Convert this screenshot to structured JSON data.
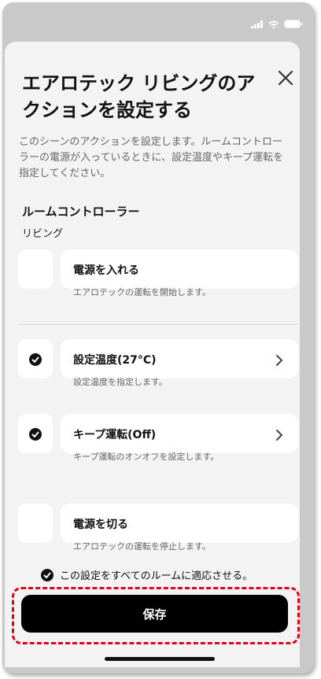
{
  "header": {
    "title": "エアロテック リビングのアクションを設定する"
  },
  "description": "このシーンのアクションを設定します。ルームコントローラーの電源が入っているときに、設定温度やキープ運転を指定してください。",
  "section": {
    "title": "ルームコントローラー",
    "room": "リビング"
  },
  "actions": [
    {
      "title": "電源を入れる",
      "desc": "エアロテックの運転を開始します。",
      "checked": false
    },
    {
      "title": "設定温度(27°C)",
      "desc": "設定温度を指定します。",
      "checked": true
    },
    {
      "title": "キープ運転(Off)",
      "desc": "キープ運転のオンオフを設定します。",
      "checked": true
    },
    {
      "title": "電源を切る",
      "desc": "エアロテックの運転を停止します。",
      "checked": false
    }
  ],
  "apply_all": {
    "label": "この設定をすべてのルームに適応させる。",
    "checked": true
  },
  "save_label": "保存",
  "colors": {
    "highlight": "#e0001a",
    "primary": "#000000"
  }
}
